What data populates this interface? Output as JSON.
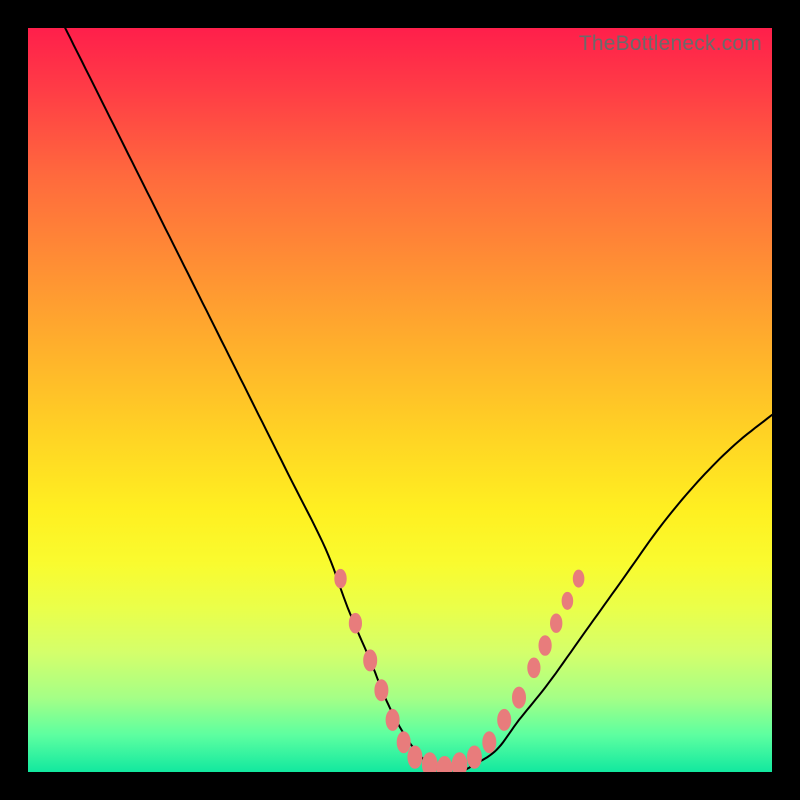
{
  "watermark": "TheBottleneck.com",
  "chart_data": {
    "type": "line",
    "title": "",
    "xlabel": "",
    "ylabel": "",
    "xlim": [
      0,
      100
    ],
    "ylim": [
      0,
      100
    ],
    "series": [
      {
        "name": "curve",
        "x": [
          5,
          10,
          15,
          20,
          25,
          30,
          35,
          40,
          43,
          46,
          48,
          50,
          52,
          54,
          56,
          58,
          60,
          63,
          66,
          70,
          75,
          80,
          85,
          90,
          95,
          100
        ],
        "y": [
          100,
          90,
          80,
          70,
          60,
          50,
          40,
          30,
          22,
          15,
          10,
          6,
          3,
          1,
          0,
          0,
          1,
          3,
          7,
          12,
          19,
          26,
          33,
          39,
          44,
          48
        ]
      }
    ],
    "markers": [
      {
        "x": 42,
        "y": 26,
        "r": 1.4
      },
      {
        "x": 44,
        "y": 20,
        "r": 1.5
      },
      {
        "x": 46,
        "y": 15,
        "r": 1.6
      },
      {
        "x": 47.5,
        "y": 11,
        "r": 1.6
      },
      {
        "x": 49,
        "y": 7,
        "r": 1.6
      },
      {
        "x": 50.5,
        "y": 4,
        "r": 1.6
      },
      {
        "x": 52,
        "y": 2,
        "r": 1.7
      },
      {
        "x": 54,
        "y": 1,
        "r": 1.8
      },
      {
        "x": 56,
        "y": 0.5,
        "r": 1.8
      },
      {
        "x": 58,
        "y": 1,
        "r": 1.8
      },
      {
        "x": 60,
        "y": 2,
        "r": 1.7
      },
      {
        "x": 62,
        "y": 4,
        "r": 1.6
      },
      {
        "x": 64,
        "y": 7,
        "r": 1.6
      },
      {
        "x": 66,
        "y": 10,
        "r": 1.6
      },
      {
        "x": 68,
        "y": 14,
        "r": 1.5
      },
      {
        "x": 69.5,
        "y": 17,
        "r": 1.5
      },
      {
        "x": 71,
        "y": 20,
        "r": 1.4
      },
      {
        "x": 72.5,
        "y": 23,
        "r": 1.3
      },
      {
        "x": 74,
        "y": 26,
        "r": 1.3
      }
    ]
  }
}
